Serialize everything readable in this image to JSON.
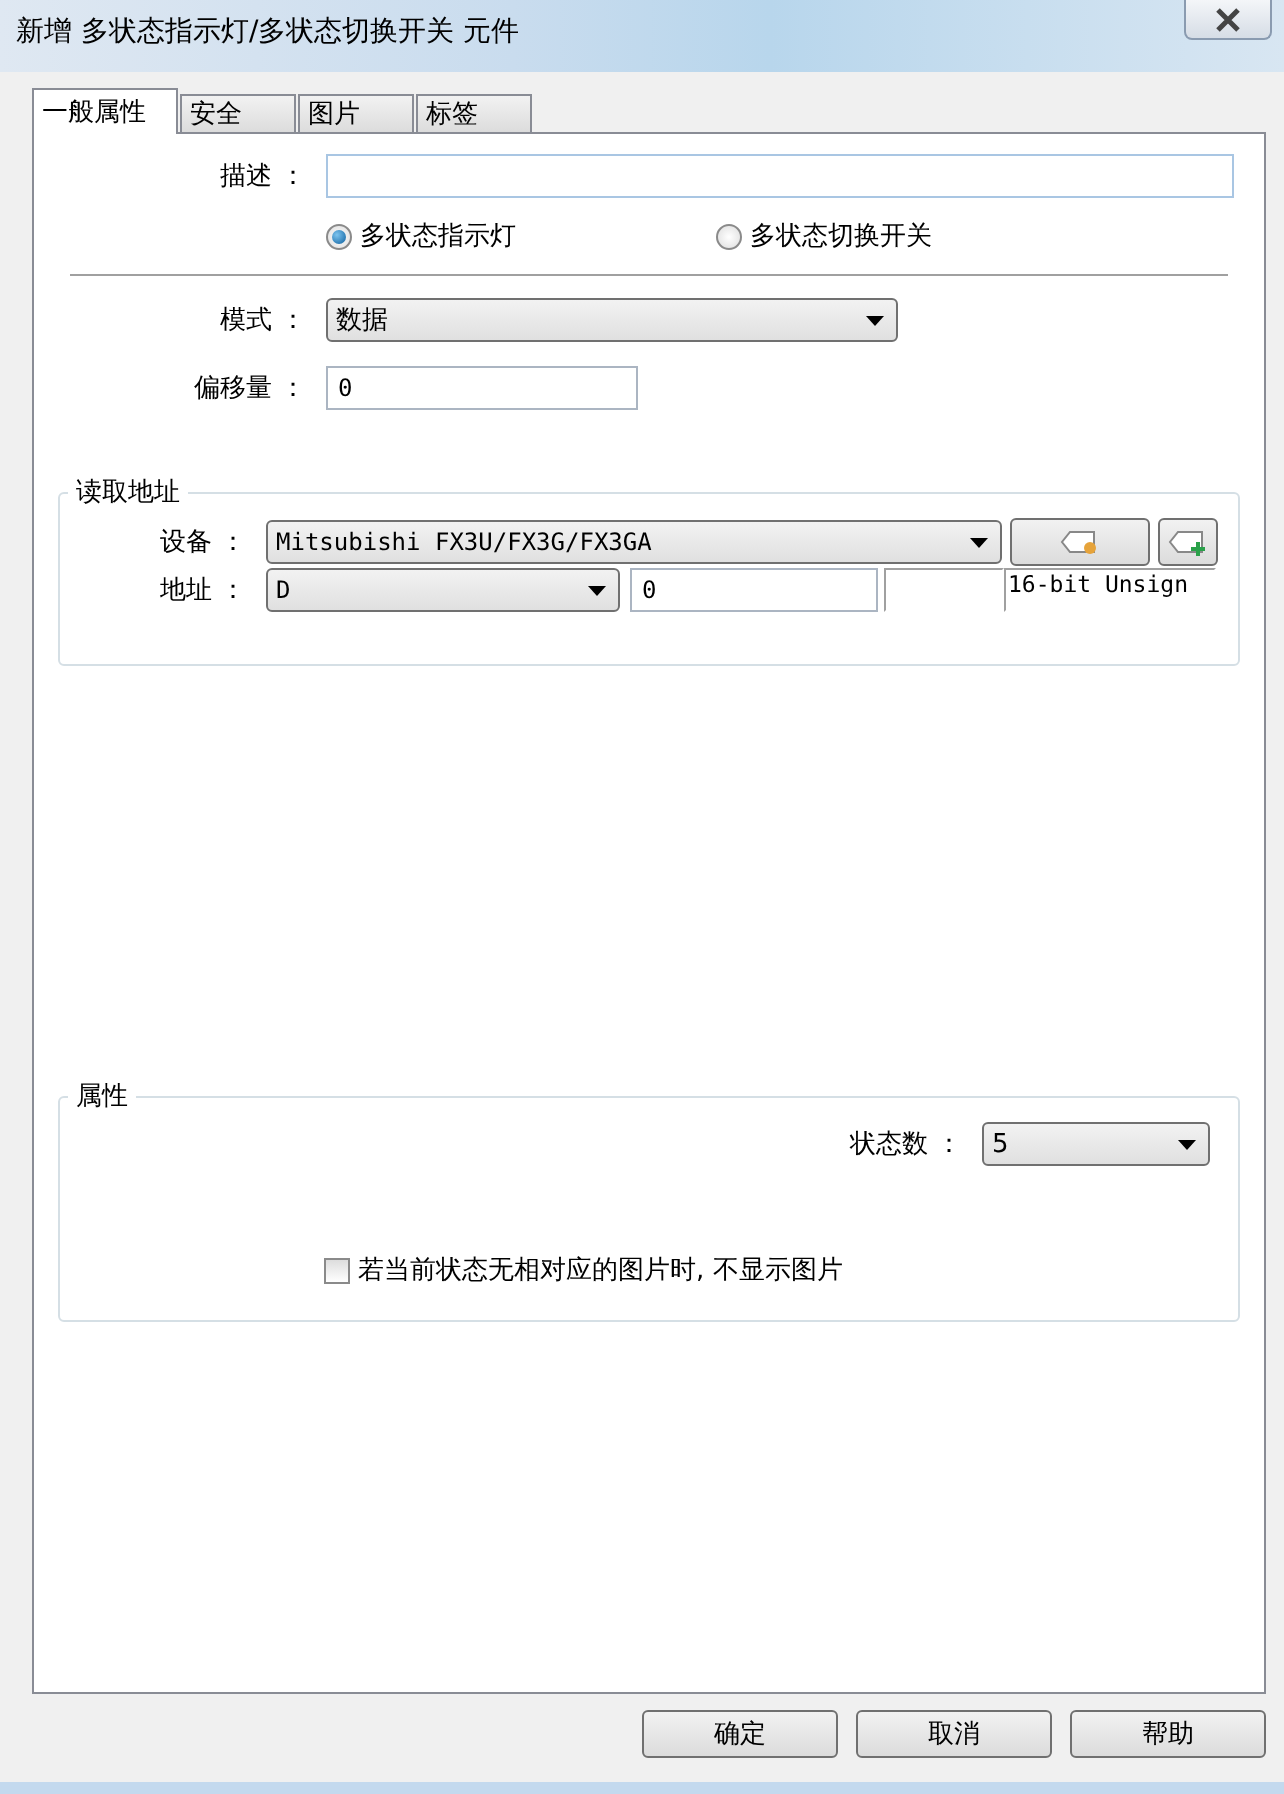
{
  "window": {
    "title": "新增 多状态指示灯/多状态切换开关 元件"
  },
  "tabs": [
    {
      "label": "一般属性",
      "selected": true
    },
    {
      "label": "安全",
      "selected": false
    },
    {
      "label": "图片",
      "selected": false
    },
    {
      "label": "标签",
      "selected": false
    }
  ],
  "description": {
    "label": "描述 ："
  },
  "type_options": [
    {
      "label": "多状态指示灯",
      "selected": true
    },
    {
      "label": "多状态切换开关",
      "selected": false
    }
  ],
  "mode": {
    "label": "模式 ：",
    "value": "数据"
  },
  "offset": {
    "label": "偏移量 ：",
    "value": "0"
  },
  "read_address": {
    "title": "读取地址",
    "device": {
      "label": "设备 ：",
      "value": "Mitsubishi FX3U/FX3G/FX3GA"
    },
    "address": {
      "label": "地址 ：",
      "type": "D",
      "value": "0",
      "data_type": "16-bit Unsign"
    }
  },
  "properties": {
    "title": "属性",
    "state_count": {
      "label": "状态数 ：",
      "value": "5"
    },
    "hide_missing_picture": {
      "label": "若当前状态无相对应的图片时, 不显示图片",
      "checked": false
    }
  },
  "buttons": [
    "确定",
    "取消",
    "帮助"
  ]
}
